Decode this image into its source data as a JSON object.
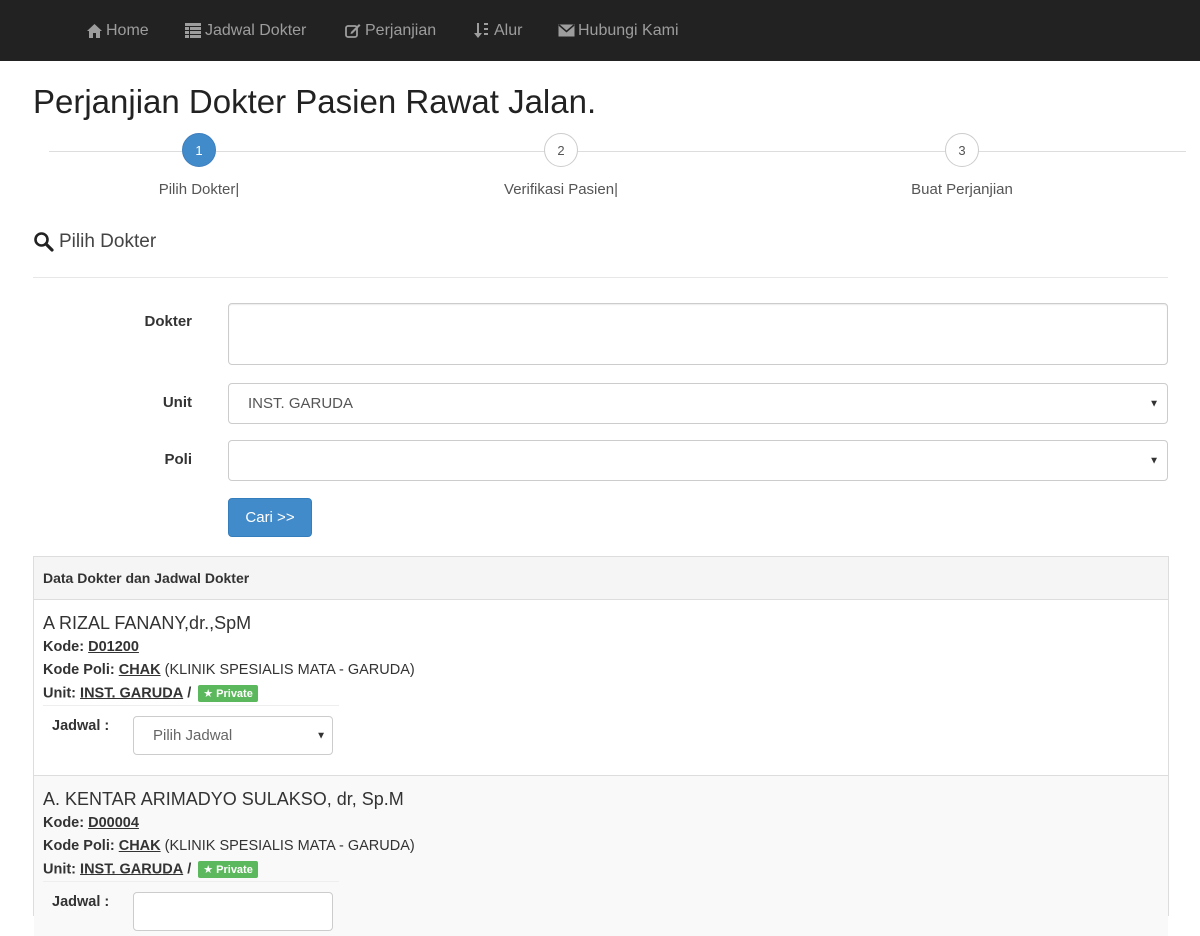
{
  "nav": {
    "items": [
      {
        "label": "Home",
        "icon": "home-icon"
      },
      {
        "label": "Jadwal Dokter",
        "icon": "table-icon"
      },
      {
        "label": "Perjanjian",
        "icon": "edit-icon"
      },
      {
        "label": "Alur",
        "icon": "sort-icon"
      },
      {
        "label": "Hubungi Kami",
        "icon": "envelope-icon"
      }
    ]
  },
  "page_title": "Perjanjian Dokter Pasien Rawat Jalan.",
  "stepper": {
    "steps": [
      {
        "number": "1",
        "label": "Pilih Dokter|",
        "active": true
      },
      {
        "number": "2",
        "label": "Verifikasi Pasien|",
        "active": false
      },
      {
        "number": "3",
        "label": "Buat Perjanjian",
        "active": false
      }
    ]
  },
  "section_title": "Pilih Dokter",
  "form": {
    "dokter_label": "Dokter",
    "dokter_value": "",
    "unit_label": "Unit",
    "unit_value": "INST. GARUDA",
    "poli_label": "Poli",
    "poli_value": "",
    "cari_button": "Cari >>"
  },
  "panel": {
    "title": "Data Dokter dan Jadwal Dokter",
    "kode_label": "Kode:",
    "kode_poli_label": "Kode Poli:",
    "unit_label": "Unit:",
    "jadwal_label": "Jadwal :",
    "doctors": [
      {
        "name": "A RIZAL FANANY,dr.,SpM",
        "kode": "D01200",
        "kode_poli": "CHAK",
        "poli_name": "(KLINIK SPESIALIS MATA - GARUDA)",
        "unit": "INST. GARUDA",
        "unit_sep": "/",
        "badge": "Private",
        "jadwal_placeholder": "Pilih Jadwal"
      },
      {
        "name": "A. KENTAR ARIMADYO SULAKSO, dr, Sp.M",
        "kode": "D00004",
        "kode_poli": "CHAK",
        "poli_name": "(KLINIK SPESIALIS MATA - GARUDA)",
        "unit": "INST. GARUDA",
        "unit_sep": "/",
        "badge": "Private",
        "jadwal_placeholder": ""
      }
    ]
  },
  "colors": {
    "navbar": "#222222",
    "nav_text": "#9d9d9d",
    "primary": "#428bca",
    "badge_green": "#5cb85c"
  }
}
